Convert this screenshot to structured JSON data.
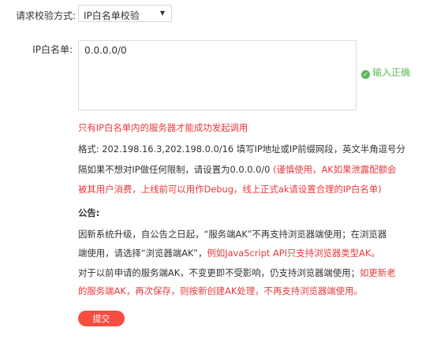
{
  "form": {
    "method_label": "请求校验方式:",
    "method_value": "IP白名单校验",
    "whitelist_label": "IP白名单:",
    "whitelist_value": "0.0.0.0/0",
    "valid_text": "输入正确"
  },
  "notes": {
    "warning": "只有IP白名单内的服务器才能成功发起调用",
    "format_line1": "格式: 202.198.16.3,202.198.0.0/16 填写IP地址或IP前缀网段，英文半角逗号分",
    "format_line2_black": "隔如果不想对IP做任何限制，请设置为0.0.0.0/0 ",
    "format_line2_red": "(谨慎使用，AK如果泄露配额会",
    "format_line3_red": "被其用户消费，上线前可以用作Debug，线上正式ak请设置合理的IP白名单)"
  },
  "announcement": {
    "title": "公告:",
    "line1": "因新系统升级，自公告之日起，“服务端AK”不再支持浏览器端使用；在浏览器",
    "line2_black": "端使用，请选择“浏览器端AK”，",
    "line2_red": "例如JavaScript API只支持浏览器类型AK。",
    "line3_black": "对于以前申请的服务端AK，不变更即不受影响，仍支持浏览器端使用；",
    "line3_red": "如更新老",
    "line4_red": "的服务端AK，再次保存，则按新创建AK处理，不再支持浏览器端使用。"
  },
  "submit_label": "提交",
  "colors": {
    "accent_red": "#e8383d",
    "button": "#f64d41",
    "success": "#5cb85c"
  }
}
